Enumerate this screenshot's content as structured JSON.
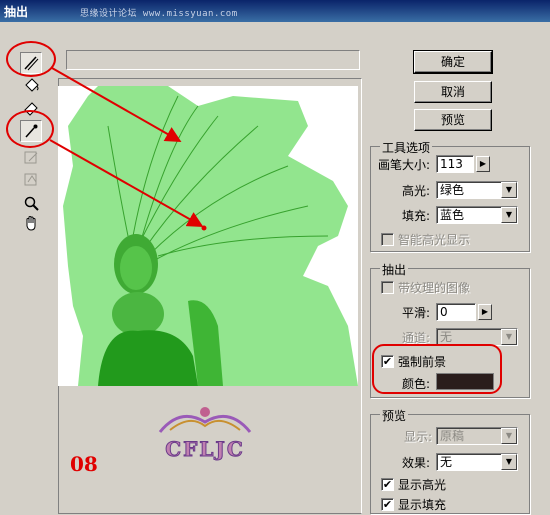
{
  "window": {
    "title": "抽出",
    "watermark": "思缘设计论坛 www.missyuan.com"
  },
  "buttons": {
    "ok": "确定",
    "cancel": "取消",
    "preview": "预览"
  },
  "tool_options": {
    "title": "工具选项",
    "brush_size_label": "画笔大小:",
    "brush_size_value": "113",
    "highlight_label": "高光:",
    "highlight_value": "绿色",
    "fill_label": "填充:",
    "fill_value": "蓝色",
    "smart_highlight_label": "智能高光显示"
  },
  "extract": {
    "title": "抽出",
    "textured_label": "带纹理的图像",
    "smooth_label": "平滑:",
    "smooth_value": "0",
    "channel_label": "通道:",
    "channel_value": "无",
    "force_fg_label": "强制前景",
    "force_fg_checked": "✔",
    "color_label": "颜色:",
    "color_value": "#2a1d1c"
  },
  "preview": {
    "title": "预览",
    "show_label": "显示:",
    "show_value": "原稿",
    "effect_label": "效果:",
    "effect_value": "无",
    "show_highlight_label": "显示高光",
    "show_highlight_checked": "✔",
    "show_fill_label": "显示填充",
    "show_fill_checked": "✔"
  },
  "annotations": {
    "step_number": "08",
    "logo_text": "CFLJC",
    "highlight_color": "#e00000"
  }
}
